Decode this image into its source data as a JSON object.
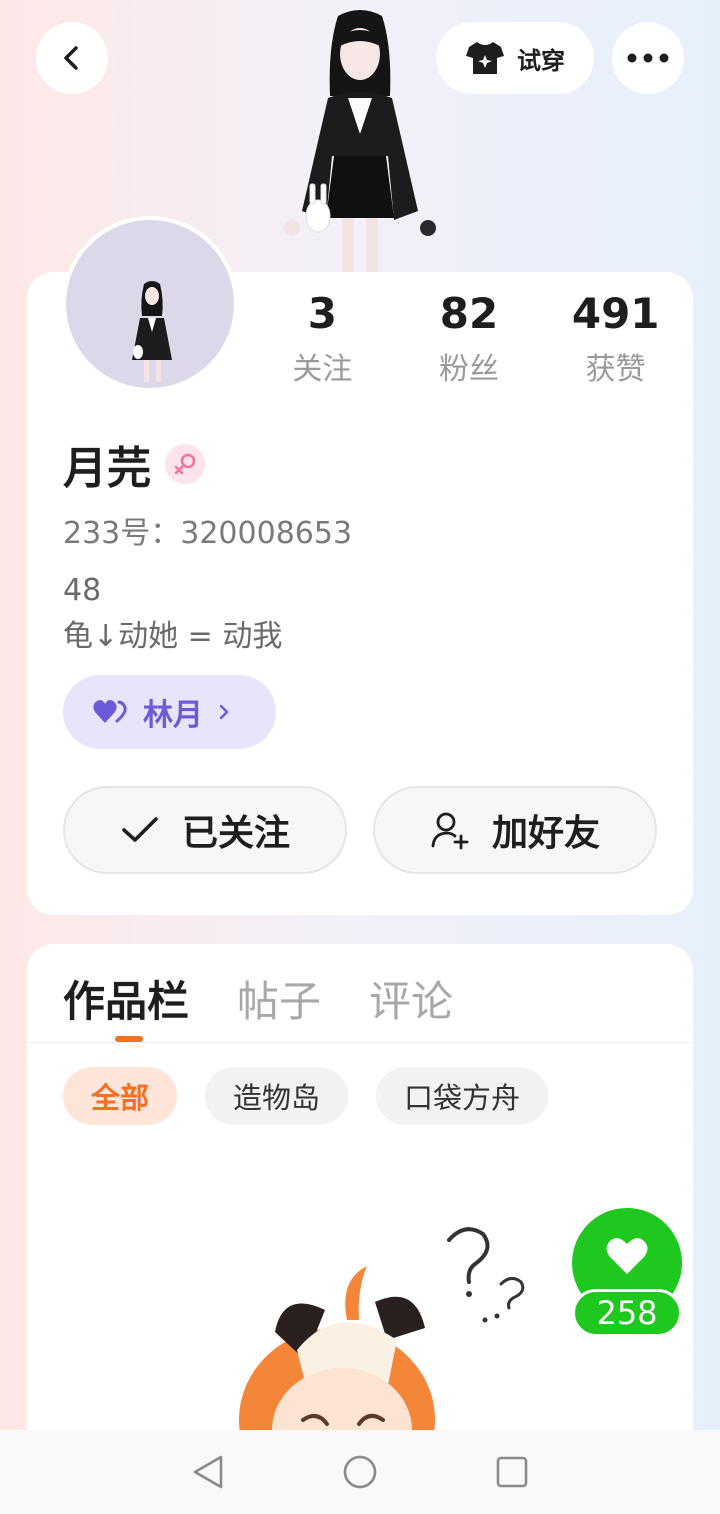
{
  "header": {
    "tryon_label": "试穿",
    "icons": {
      "back": "chevron-left-icon",
      "more": "more-dots-icon",
      "tryon": "tshirt-icon"
    }
  },
  "profile": {
    "stats": [
      {
        "value": "3",
        "label": "关注"
      },
      {
        "value": "82",
        "label": "粉丝"
      },
      {
        "value": "491",
        "label": "获赞"
      }
    ],
    "nickname": "月芫",
    "gender_icon": "female-symbol-icon",
    "uid_text": "233号：320008653",
    "bio_lines": [
      "48",
      "龟↓动她 = 动我"
    ],
    "cp_tag": {
      "label": "林月",
      "icon": "heart-icon"
    },
    "follow_button": "已关注",
    "add_friend_button": "加好友"
  },
  "content": {
    "tabs": [
      "作品栏",
      "帖子",
      "评论"
    ],
    "active_tab": "作品栏",
    "filter_chips": [
      "全部",
      "造物岛",
      "口袋方舟"
    ],
    "active_chip": "全部"
  },
  "like_fab": {
    "count": "258",
    "icon": "heart-icon"
  },
  "colors": {
    "accent_orange": "#f37123",
    "like_green": "#1ec81e",
    "cp_purple": "#6b5bd8"
  }
}
